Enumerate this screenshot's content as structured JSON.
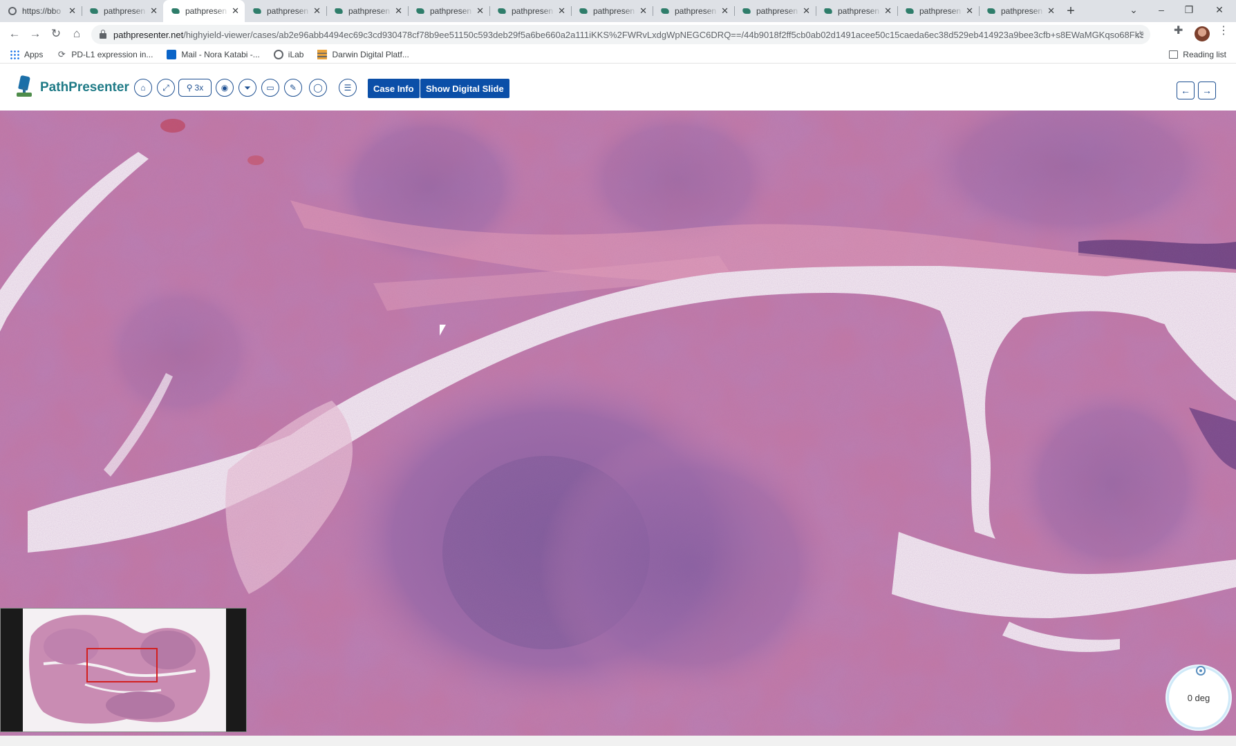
{
  "browser": {
    "tabs": [
      {
        "title": "https://bbo",
        "icon": "globe-icon",
        "active": false
      },
      {
        "title": "pathpresen",
        "icon": "pathpresenter-favicon",
        "active": false
      },
      {
        "title": "pathpresen",
        "icon": "pathpresenter-favicon",
        "active": true
      },
      {
        "title": "pathpresen",
        "icon": "pathpresenter-favicon",
        "active": false
      },
      {
        "title": "pathpresen",
        "icon": "pathpresenter-favicon",
        "active": false
      },
      {
        "title": "pathpresen",
        "icon": "pathpresenter-favicon",
        "active": false
      },
      {
        "title": "pathpresen",
        "icon": "pathpresenter-favicon",
        "active": false
      },
      {
        "title": "pathpresen",
        "icon": "pathpresenter-favicon",
        "active": false
      },
      {
        "title": "pathpresen",
        "icon": "pathpresenter-favicon",
        "active": false
      },
      {
        "title": "pathpresen",
        "icon": "pathpresenter-favicon",
        "active": false
      },
      {
        "title": "pathpresen",
        "icon": "pathpresenter-favicon",
        "active": false
      },
      {
        "title": "pathpresen",
        "icon": "pathpresenter-favicon",
        "active": false
      },
      {
        "title": "pathpresen",
        "icon": "pathpresenter-favicon",
        "active": false
      }
    ],
    "url_domain": "pathpresenter.net",
    "url_path": "/highyield-viewer/cases/ab2e96abb4494ec69c3cd930478cf78b9ee51150c593deb29f5a6be660a2a111iKKS%2FWRvLxdgWpNEGC6DRQ==/44b9018f2ff5cb0ab02d1491acee50c15caeda6ec38d529eb414923a9bee3cfb+s8EWaMGKqso68FkSZJA...",
    "bookmarks": [
      {
        "label": "Apps",
        "icon": "apps-grid-icon"
      },
      {
        "label": "PD-L1 expression in...",
        "icon": "link-icon"
      },
      {
        "label": "Mail - Nora Katabi -...",
        "icon": "outlook-icon"
      },
      {
        "label": "iLab",
        "icon": "globe-icon"
      },
      {
        "label": "Darwin Digital Platf...",
        "icon": "darwin-icon"
      }
    ],
    "reading_list": "Reading list"
  },
  "app": {
    "brand": "PathPresenter",
    "toolbar": {
      "zoom_label": "3x",
      "case_info": "Case Info",
      "show_digital_slide": "Show Digital Slide",
      "icons": [
        "home-icon",
        "fullscreen-icon",
        "zoom-icon",
        "camera-icon",
        "filter-icon",
        "monitor-icon",
        "pencil-icon",
        "circle-draw-icon",
        "list-icon"
      ]
    },
    "nav": {
      "prev": "←",
      "next": "→"
    },
    "viewer": {
      "rotation_label": "0 deg",
      "stain_colors": {
        "background": "#c97aa8",
        "whitespace": "#f6eff4",
        "lymphoid": "#8a5a96",
        "stroma": "#d98aab"
      }
    }
  }
}
